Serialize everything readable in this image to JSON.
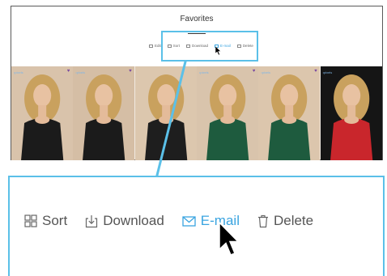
{
  "page": {
    "title": "Favorites"
  },
  "mini_toolbar": [
    {
      "label": "Edit",
      "icon": "edit-icon"
    },
    {
      "label": "Sort",
      "icon": "sort-icon"
    },
    {
      "label": "Download",
      "icon": "download-icon"
    },
    {
      "label": "E-mail",
      "icon": "email-icon",
      "active": true
    },
    {
      "label": "Delete",
      "icon": "trash-icon"
    }
  ],
  "photos": [
    {
      "label": "•pixels",
      "favorite": true,
      "bg": "#d9c3ab",
      "dress": "#1b1b1b"
    },
    {
      "label": "•pixels",
      "favorite": true,
      "bg": "#d5bea5",
      "dress": "#1b1b1b"
    },
    {
      "label": "",
      "favorite": false,
      "bg": "#dcc7ae",
      "dress": "#1e1e1e"
    },
    {
      "label": "•pixels",
      "favorite": true,
      "bg": "#d9c4ac",
      "dress": "#1e5b3e"
    },
    {
      "label": "•pixels",
      "favorite": true,
      "bg": "#dcc6ad",
      "dress": "#1e5b3e"
    },
    {
      "label": "•pixels",
      "favorite": false,
      "bg": "#151515",
      "dress": "#c9262c"
    }
  ],
  "zoom_toolbar": [
    {
      "label": "Sort",
      "icon": "sort-icon"
    },
    {
      "label": "Download",
      "icon": "download-icon"
    },
    {
      "label": "E-mail",
      "icon": "email-icon",
      "active": true
    },
    {
      "label": "Delete",
      "icon": "trash-icon"
    }
  ],
  "colors": {
    "accent": "#3aa4e0",
    "callout": "#5bc0e8",
    "heart": "#7a4aa0"
  }
}
